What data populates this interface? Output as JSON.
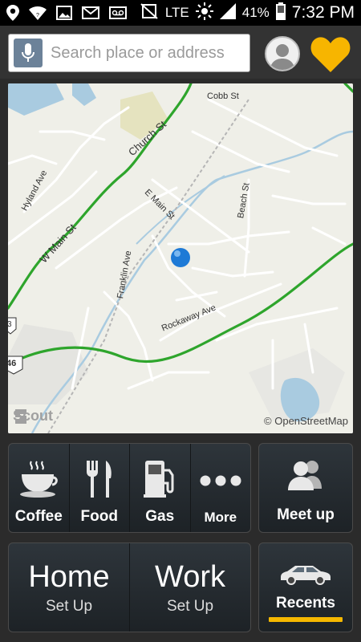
{
  "status_bar": {
    "network": "LTE",
    "battery": "41%",
    "time": "7:32 PM",
    "left_icons": [
      "location-icon",
      "wifi-icon",
      "image-icon",
      "gmail-icon",
      "voicemail-icon"
    ],
    "right_icons": [
      "mute-icon",
      "brightness-icon",
      "signal-icon",
      "battery-icon"
    ]
  },
  "search": {
    "placeholder": "Search place or address"
  },
  "map": {
    "streets": [
      "Cobb St",
      "Church St",
      "Hyland Ave",
      "W Main St",
      "E Main St",
      "Beach St",
      "Franklin Ave",
      "Rockaway Ave"
    ],
    "route_shields": [
      "3",
      "46"
    ],
    "logo": "Scout",
    "attribution": "© OpenStreetMap"
  },
  "quick_actions": [
    {
      "label": "Coffee",
      "icon": "coffee-cup-icon"
    },
    {
      "label": "Food",
      "icon": "fork-knife-icon"
    },
    {
      "label": "Gas",
      "icon": "gas-pump-icon"
    },
    {
      "label": "More",
      "icon": "more-dots-icon"
    }
  ],
  "meetup": {
    "label": "Meet up",
    "icon": "people-icon"
  },
  "places": [
    {
      "name": "Home",
      "sub": "Set Up"
    },
    {
      "name": "Work",
      "sub": "Set Up"
    }
  ],
  "recents": {
    "label": "Recents",
    "icon": "car-icon"
  },
  "colors": {
    "accent": "#f5b800",
    "route": "#2ea52c",
    "water": "#a9cbe0",
    "location_dot": "#1e7ad6"
  }
}
